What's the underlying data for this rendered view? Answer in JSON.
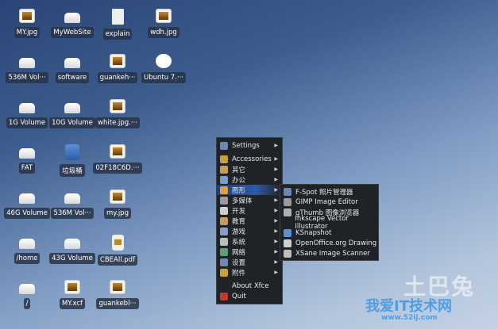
{
  "desktop_icons": [
    {
      "label": "MY.jpg",
      "type": "image",
      "col": 0,
      "row": 0
    },
    {
      "label": "MyWebSite",
      "type": "drive",
      "col": 1,
      "row": 0
    },
    {
      "label": "explain",
      "type": "doc",
      "col": 2,
      "row": 0
    },
    {
      "label": "wdh.jpg",
      "type": "image",
      "col": 3,
      "row": 0
    },
    {
      "label": "536M Vol···",
      "type": "drive",
      "col": 0,
      "row": 1
    },
    {
      "label": "software",
      "type": "drive",
      "col": 1,
      "row": 1
    },
    {
      "label": "guankeh···",
      "type": "image",
      "col": 2,
      "row": 1
    },
    {
      "label": "Ubuntu 7.···",
      "type": "cd",
      "col": 3,
      "row": 1
    },
    {
      "label": "1G Volume",
      "type": "drive",
      "col": 0,
      "row": 2
    },
    {
      "label": "10G Volume",
      "type": "drive",
      "col": 1,
      "row": 2
    },
    {
      "label": "white.jpg.···",
      "type": "image",
      "col": 2,
      "row": 2
    },
    {
      "label": "FAT",
      "type": "drive",
      "col": 0,
      "row": 3
    },
    {
      "label": "垃圾桶",
      "type": "trash",
      "col": 1,
      "row": 3
    },
    {
      "label": "02F18C6D.···",
      "type": "image",
      "col": 2,
      "row": 3
    },
    {
      "label": "46G Volume",
      "type": "drive",
      "col": 0,
      "row": 4
    },
    {
      "label": "536M Vol···",
      "type": "drive",
      "col": 1,
      "row": 4
    },
    {
      "label": "my.jpg",
      "type": "image",
      "col": 2,
      "row": 4
    },
    {
      "label": "/home",
      "type": "drive",
      "col": 0,
      "row": 5
    },
    {
      "label": "43G Volume",
      "type": "drive",
      "col": 1,
      "row": 5
    },
    {
      "label": "CBEAll.pdf",
      "type": "pdf",
      "col": 2,
      "row": 5
    },
    {
      "label": "/",
      "type": "drive",
      "col": 0,
      "row": 6
    },
    {
      "label": "MY.xcf",
      "type": "image",
      "col": 1,
      "row": 6
    },
    {
      "label": "guankebl···",
      "type": "image",
      "col": 2,
      "row": 6
    }
  ],
  "menu": {
    "items": [
      {
        "label": "Settings",
        "icon": "settings-icon",
        "color": "#6f87b5",
        "submenu": true
      },
      {
        "sep": true
      },
      {
        "label": "Accessories",
        "icon": "accessories-icon",
        "color": "#c7a03a",
        "submenu": true
      },
      {
        "label": "其它",
        "icon": "other-icon",
        "color": "#c99b5a",
        "submenu": true
      },
      {
        "label": "办公",
        "icon": "office-icon",
        "color": "#7d9bc7",
        "submenu": true
      },
      {
        "label": "图形",
        "icon": "graphics-icon",
        "color": "#d9a24a",
        "submenu": true,
        "active": true
      },
      {
        "label": "多媒体",
        "icon": "multimedia-icon",
        "color": "#9a9a9a",
        "submenu": true
      },
      {
        "label": "开发",
        "icon": "development-icon",
        "color": "#cfcfcf",
        "submenu": true
      },
      {
        "label": "教育",
        "icon": "education-icon",
        "color": "#c99b5a",
        "submenu": true
      },
      {
        "label": "游戏",
        "icon": "games-icon",
        "color": "#8a9cc5",
        "submenu": true
      },
      {
        "label": "系统",
        "icon": "system-icon",
        "color": "#bdbdbd",
        "submenu": true
      },
      {
        "label": "网络",
        "icon": "network-icon",
        "color": "#5aa07a",
        "submenu": true
      },
      {
        "label": "设置",
        "icon": "preferences-icon",
        "color": "#6f87b5",
        "submenu": true
      },
      {
        "label": "附件",
        "icon": "accessories-icon",
        "color": "#c7a03a",
        "submenu": true
      },
      {
        "sep": true
      },
      {
        "label": "About Xfce",
        "icon": "",
        "submenu": false
      },
      {
        "label": "Quit",
        "icon": "quit-icon",
        "color": "#c0392b",
        "submenu": false
      }
    ]
  },
  "submenu": {
    "items": [
      {
        "label": "F-Spot 照片管理器",
        "icon": "f-spot-icon",
        "color": "#6f87b5"
      },
      {
        "label": "GIMP Image Editor",
        "icon": "gimp-icon",
        "color": "#9a9a9a"
      },
      {
        "label": "gThumb 图像浏览器",
        "icon": "gthumb-icon",
        "color": "#b0b0b0"
      },
      {
        "label": "Inkscape Vector Illustrator",
        "icon": "inkscape-icon",
        "color": "#222222"
      },
      {
        "label": "KSnapshot",
        "icon": "ksnapshot-icon",
        "color": "#5c8fd6"
      },
      {
        "label": "OpenOffice.org Drawing",
        "icon": "openoffice-draw-icon",
        "color": "#cfcfcf"
      },
      {
        "label": "XSane Image Scanner",
        "icon": "xsane-icon",
        "color": "#bdbdbd"
      }
    ]
  },
  "watermark": {
    "brand": "土巴兔",
    "site_name": "我爱IT技术网",
    "url": "www.52ij.com"
  }
}
